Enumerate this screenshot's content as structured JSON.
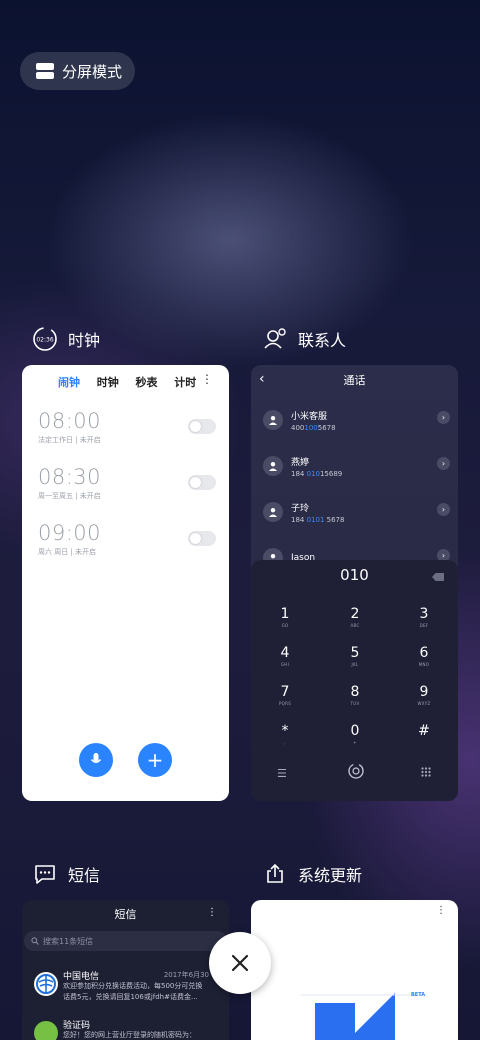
{
  "split_mode": {
    "label": "分屏模式"
  },
  "clock_app": {
    "title": "时钟",
    "icon_time": "02:36",
    "tabs": [
      "闹钟",
      "时钟",
      "秒表",
      "计时"
    ],
    "alarms": [
      {
        "time": "08:00",
        "desc": "法定工作日 | 未开启"
      },
      {
        "time": "08:30",
        "desc": "周一至周五 | 未开启"
      },
      {
        "time": "09:00",
        "desc": "周六 周日 | 未开启"
      }
    ]
  },
  "contacts_app": {
    "title": "联系人",
    "header": "通话",
    "contacts": [
      {
        "name": "小米客服",
        "num_pre": "400",
        "num_hl": "100",
        "num_post": "5678"
      },
      {
        "name": "燕婷",
        "num_pre": "184 ",
        "num_hl": "010",
        "num_post": "15689"
      },
      {
        "name": "子玲",
        "num_pre": "184 ",
        "num_hl": "0101",
        "num_post": " 5678"
      },
      {
        "name": "Jason",
        "num_pre": "",
        "num_hl": "",
        "num_post": ""
      }
    ],
    "dial_input": "010",
    "keys": [
      {
        "d": "1",
        "l": "GO"
      },
      {
        "d": "2",
        "l": "ABC"
      },
      {
        "d": "3",
        "l": "DEF"
      },
      {
        "d": "4",
        "l": "GHI"
      },
      {
        "d": "5",
        "l": "JKL"
      },
      {
        "d": "6",
        "l": "MNO"
      },
      {
        "d": "7",
        "l": "PQRS"
      },
      {
        "d": "8",
        "l": "TUV"
      },
      {
        "d": "9",
        "l": "WXYZ"
      },
      {
        "d": "*",
        "l": ","
      },
      {
        "d": "0",
        "l": "+"
      },
      {
        "d": "#",
        "l": ""
      }
    ]
  },
  "sms_app": {
    "title": "短信",
    "header": "短信",
    "search_placeholder": "搜索11条短信",
    "messages": [
      {
        "sender": "中国电信",
        "date": "2017年6月30",
        "body": "欢迎参加积分兑换话费活动，每500分可兑换话费5元，兑换请回复106或jfdh#话费金..."
      },
      {
        "sender": "验证码",
        "date": "",
        "body": "您好！您的网上营业厅登录的随机密码为："
      }
    ]
  },
  "update_app": {
    "title": "系统更新",
    "beta_label": "BETA"
  },
  "colors": {
    "accent": "#2a84ff"
  }
}
